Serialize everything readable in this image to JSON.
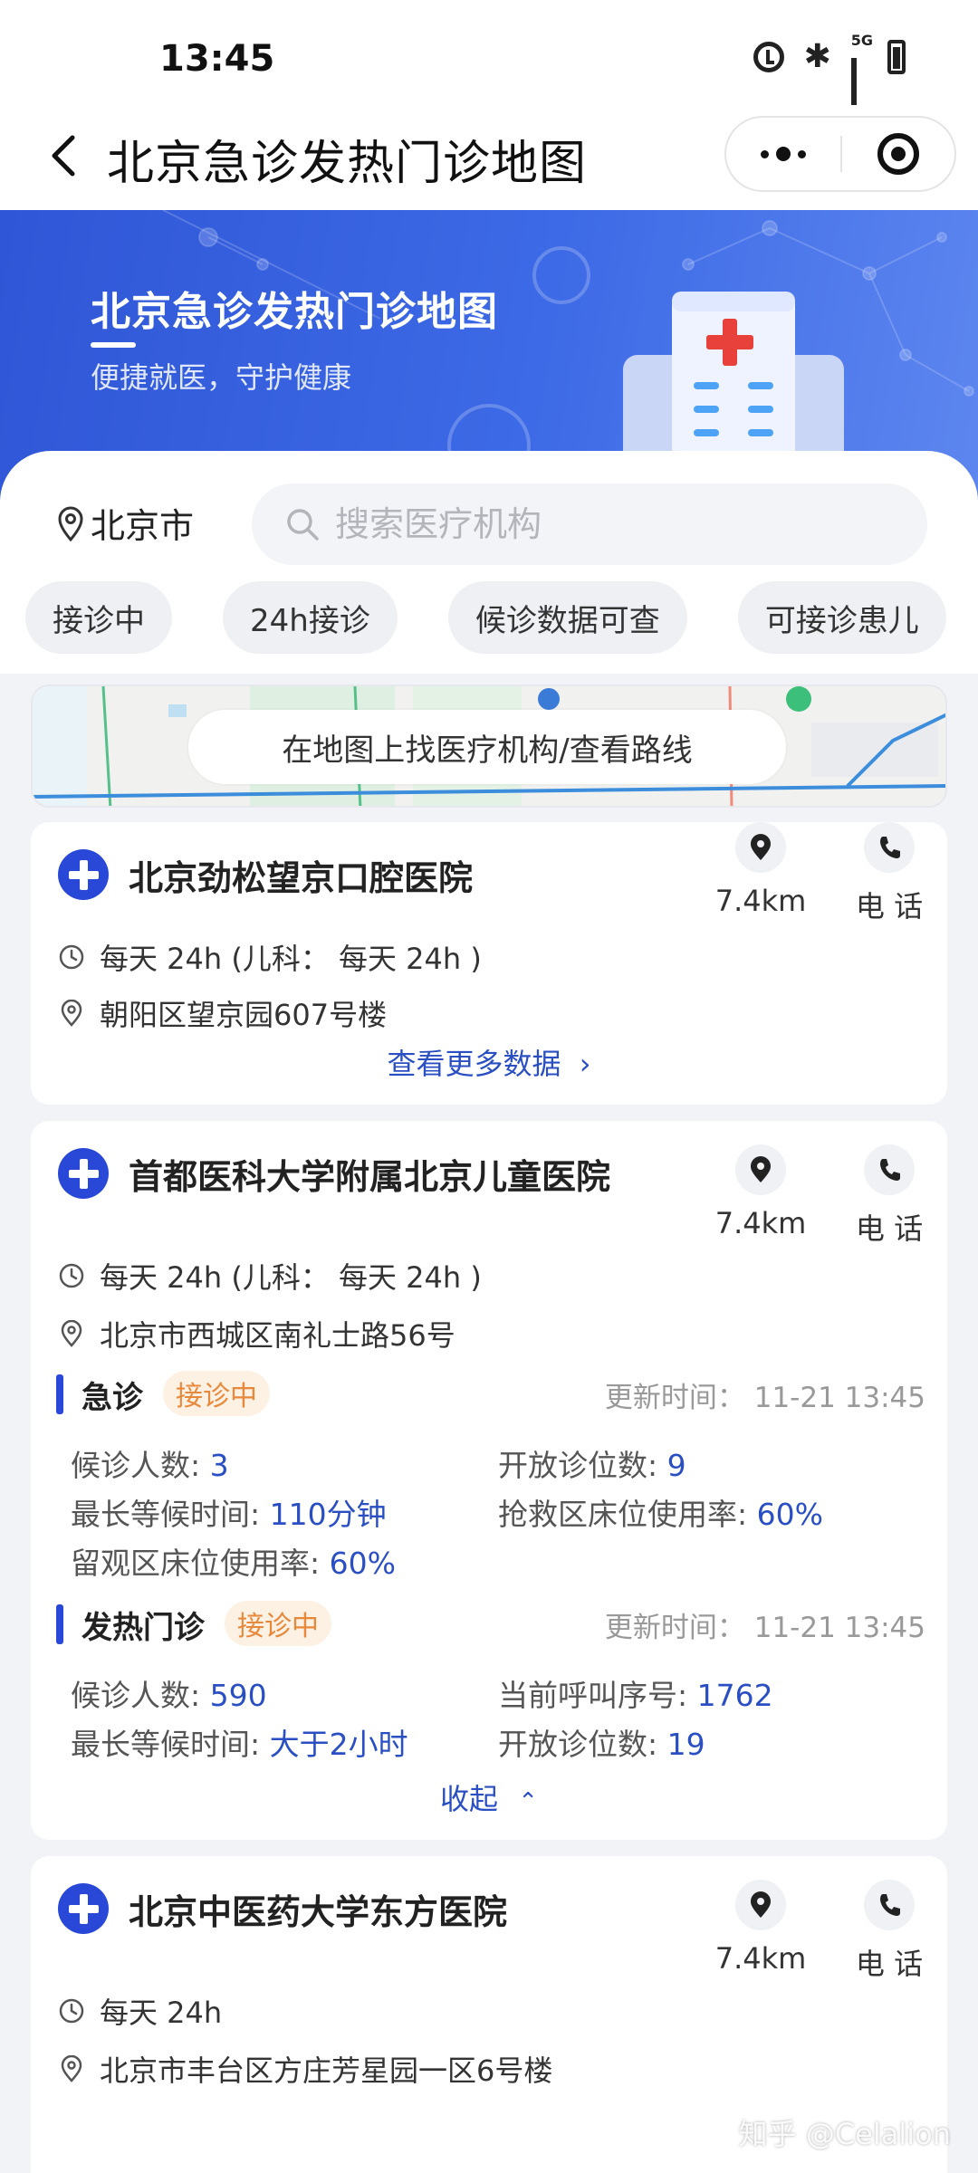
{
  "status_bar": {
    "time": "13:45",
    "network": "5G"
  },
  "nav": {
    "title": "北京急诊发热门诊地图"
  },
  "banner": {
    "title": "北京急诊发热门诊地图",
    "subtitle": "便捷就医，守护健康"
  },
  "location": {
    "city": "北京市"
  },
  "search": {
    "placeholder": "搜索医疗机构"
  },
  "filters": [
    "接诊中",
    "24h接诊",
    "候诊数据可查",
    "可接诊患儿"
  ],
  "map": {
    "button": "在地图上找医疗机构/查看路线"
  },
  "actions": {
    "phone_label": "电 话"
  },
  "hospitals": [
    {
      "name": "北京劲松望京口腔医院",
      "distance": "7.4km",
      "hours": "每天 24h (儿科： 每天 24h )",
      "address": "朝阳区望京园607号楼",
      "more": "查看更多数据"
    },
    {
      "name": "首都医科大学附属北京儿童医院",
      "distance": "7.4km",
      "hours": "每天 24h (儿科： 每天 24h )",
      "address": "北京市西城区南礼士路56号",
      "emergency": {
        "title": "急诊",
        "badge": "接诊中",
        "updated": "更新时间：  11-21 13:45",
        "waiting_label": "候诊人数: ",
        "waiting": "3",
        "open_label": "开放诊位数: ",
        "open": "9",
        "max_wait_label": "最长等候时间: ",
        "max_wait": "110分钟",
        "rescue_label": "抢救区床位使用率: ",
        "rescue": "60%",
        "observe_label": "留观区床位使用率: ",
        "observe": "60%"
      },
      "fever": {
        "title": "发热门诊",
        "badge": "接诊中",
        "updated": "更新时间：  11-21 13:45",
        "waiting_label": "候诊人数: ",
        "waiting": "590",
        "call_label": "当前呼叫序号: ",
        "call": "1762",
        "max_wait_label": "最长等候时间: ",
        "max_wait": "大于2小时",
        "open_label": "开放诊位数: ",
        "open": "19"
      },
      "collapse": "收起"
    },
    {
      "name": "北京中医药大学东方医院",
      "distance": "7.4km",
      "hours": "每天 24h",
      "address": "北京市丰台区方庄芳星园一区6号楼"
    }
  ],
  "watermark": "知乎 @Celalion",
  "colors": {
    "brand_blue": "#2a48d8",
    "link_blue": "#2a4fc2",
    "badge_orange": "#e8883a"
  }
}
